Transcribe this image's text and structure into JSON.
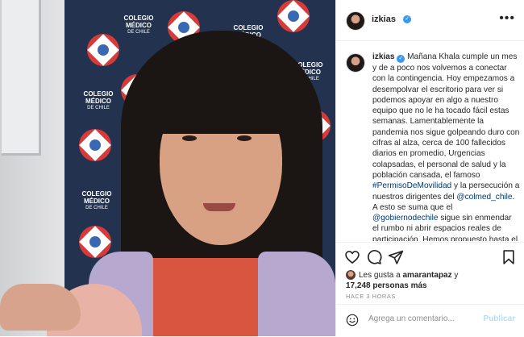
{
  "post": {
    "username": "izkias",
    "verified": true,
    "photo_brand": {
      "line1": "COLEGIO MÉDICO",
      "line2": "DE CHILE"
    }
  },
  "caption": {
    "username": "izkias",
    "text_1": "Mañana Khala cumple un mes y de a poco nos volvemos a conectar con la contingencia. Hoy empezamos a desempolvar el escritorio para ver si podemos apoyar en algo a nuestro equipo que no le ha tocado fácil estas semanas. Lamentablemente la pandemia nos sigue golpeando duro con cifras al alza, cerca de 100 fallecidos diarios en promedio, Urgencias colapsadas, el personal de salud y la población cansada, el famoso ",
    "hashtag": "#PermisoDeMovilidad",
    "text_2": " y la persecución a nuestros dirigentes del ",
    "mention_1": "@colmed_chile",
    "text_3": ". A esto se suma que el ",
    "mention_2": "@gobiernodechile",
    "text_4": " sigue sin enmendar el rumbo ni abrir espacios reales de participación. Hemos propuesto hasta el consenso que se necesite una nueva"
  },
  "actions": {
    "icons": [
      "heart-icon",
      "comment-icon",
      "share-icon",
      "bookmark-icon"
    ]
  },
  "likes": {
    "prefix": "Les gusta a ",
    "liker": "amarantapaz",
    "middle": " y",
    "count": "17,248 personas más"
  },
  "timestamp": "HACE 3 HORAS",
  "comment": {
    "placeholder": "Agrega un comentario...",
    "publish_label": "Publicar"
  },
  "colors": {
    "verified": "#3897f0",
    "link": "#00376b",
    "publish_disabled": "#b2dffc"
  }
}
